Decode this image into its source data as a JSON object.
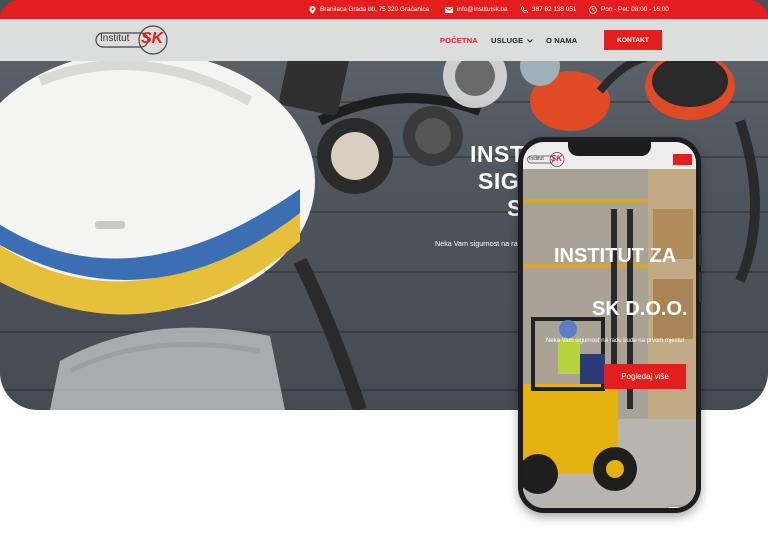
{
  "topbar": {
    "address": "Branilaca Grada bb, 75 320 Gračanica",
    "email": "info@institutsk.ba",
    "phone": "387 62 138 051",
    "hours": "Pon - Pet: 08:00 - 16:00"
  },
  "brand": {
    "word": "Institut",
    "mark": "SK"
  },
  "nav": {
    "items": [
      {
        "label": "POČETNA"
      },
      {
        "label": "USLUGE"
      },
      {
        "label": "O NAMA"
      }
    ],
    "contact_button": "KONTAKT"
  },
  "hero": {
    "title_line1": "INST",
    "title_line2": "SIGU",
    "title_line3": "S",
    "subtitle": "Neka Vam sigurnost na ra"
  },
  "mobile": {
    "title_line1": "INSTITUT ZA",
    "title_line2": "SK D.O.O.",
    "subtitle": "Neka Vam sigurnost na radu bude na prvom mjestu!",
    "cta": "Pogledaj više"
  },
  "colors": {
    "accent": "#e41e1e",
    "text_dark": "#222222"
  },
  "icons": {
    "address": "map-pin-icon",
    "email": "mail-icon",
    "phone": "phone-icon",
    "hours": "clock-icon",
    "usluge_toggle": "chevron-down-icon",
    "mobile_menu": "hamburger-menu-icon",
    "recaptcha": "recaptcha-icon"
  }
}
